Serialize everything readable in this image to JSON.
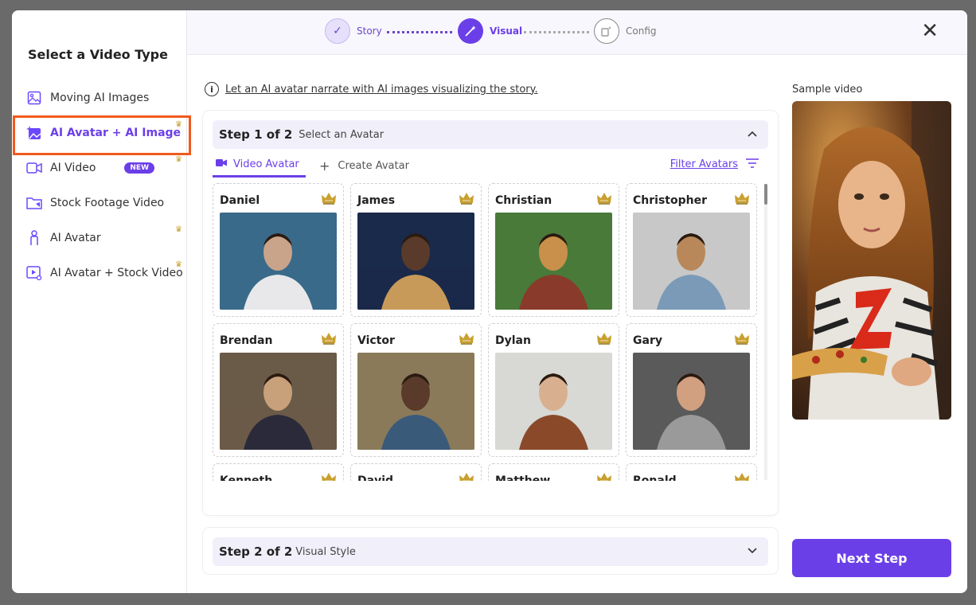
{
  "sidebar": {
    "title": "Select a Video Type",
    "items": [
      {
        "label": "Moving AI Images",
        "icon": "image-icon"
      },
      {
        "label": "AI Avatar + AI Image",
        "icon": "sparkle-image-icon"
      },
      {
        "label": "AI Video",
        "icon": "video-camera-icon",
        "badge": "NEW"
      },
      {
        "label": "Stock Footage Video",
        "icon": "folder-video-icon"
      },
      {
        "label": "AI Avatar",
        "icon": "person-icon"
      },
      {
        "label": "AI Avatar + Stock Video",
        "icon": "play-screen-icon"
      }
    ]
  },
  "stepper": {
    "steps": [
      {
        "label": "Story",
        "state": "done"
      },
      {
        "label": "Visual",
        "state": "current"
      },
      {
        "label": "Config",
        "state": "upcoming"
      }
    ]
  },
  "info": {
    "text": "Let an AI avatar narrate with AI images visualizing the story."
  },
  "step1": {
    "title": "Step 1 of 2",
    "subtitle": "Select an Avatar",
    "tabs": {
      "video_avatar": "Video Avatar",
      "create_avatar": "Create Avatar"
    },
    "filter_label": "Filter Avatars",
    "avatars": [
      "Daniel",
      "James",
      "Christian",
      "Christopher",
      "Brendan",
      "Victor",
      "Dylan",
      "Gary",
      "Kenneth",
      "David",
      "Matthew",
      "Ronald"
    ]
  },
  "step2": {
    "title": "Step 2 of 2",
    "subtitle": "Visual Style"
  },
  "sample": {
    "label": "Sample video"
  },
  "next_button": "Next Step",
  "colors": {
    "accent": "#6b3fe8",
    "highlight_border": "#f25a1d",
    "crown": "#c9a030"
  }
}
